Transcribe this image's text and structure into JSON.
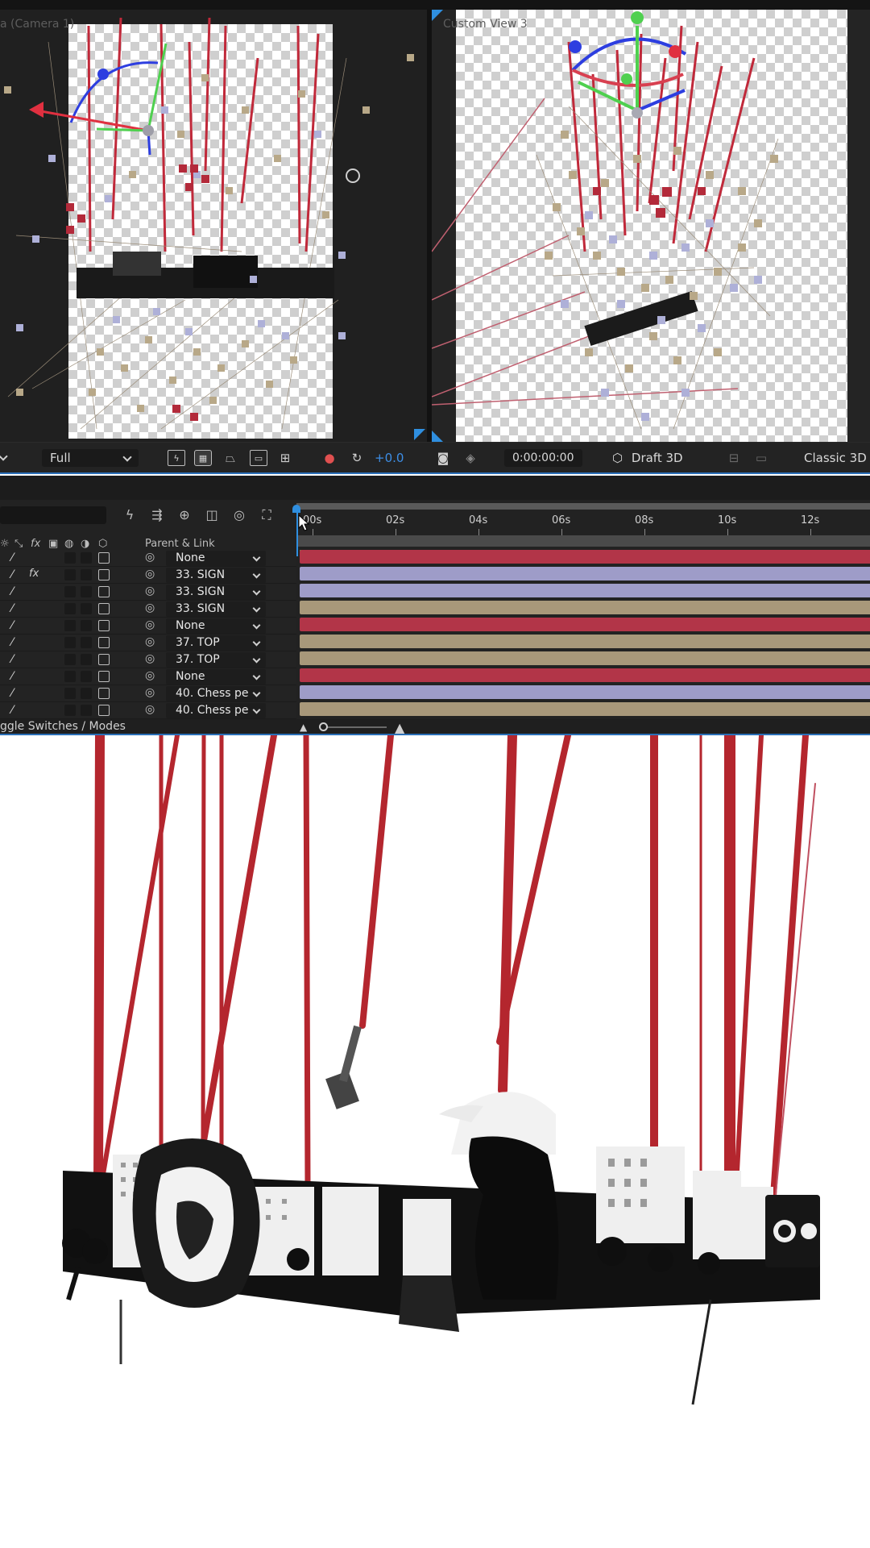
{
  "viewer": {
    "left_view_label": "a (Camera 1)",
    "right_view_label": "Custom View 3",
    "toolbar": {
      "resolution": "Full",
      "exposure": "+0.0",
      "timecode": "0:00:00:00",
      "renderer_mode": "Draft 3D",
      "renderer": "Classic 3D",
      "icons": [
        "fast-previews-icon",
        "transparency-grid-icon",
        "3d-ground-plane-icon",
        "region-of-interest-icon",
        "grid-guides-icon",
        "color-channels-icon",
        "reset-exposure-icon",
        "snapshot-camera-icon",
        "show-snapshot-icon",
        "3d-view-layout-icon",
        "display-options-icon"
      ]
    }
  },
  "timeline": {
    "ruler_labels": [
      "00s",
      "02s",
      "04s",
      "06s",
      "08s",
      "10s",
      "12s"
    ],
    "column_header": "Parent & Link",
    "footer_label": "ggle Switches / Modes",
    "layers": [
      {
        "parent": "None",
        "has_fx": false,
        "link_icon": "null",
        "track_color": "#b23548"
      },
      {
        "parent": "33. SIGN",
        "has_fx": true,
        "link_icon": "3d",
        "track_color": "#9e9cc8"
      },
      {
        "parent": "33. SIGN",
        "has_fx": false,
        "link_icon": "3d",
        "track_color": "#9e9cc8"
      },
      {
        "parent": "33. SIGN",
        "has_fx": false,
        "link_icon": "3d",
        "track_color": "#a8987a"
      },
      {
        "parent": "None",
        "has_fx": false,
        "link_icon": "null",
        "track_color": "#b23548"
      },
      {
        "parent": "37. TOP",
        "has_fx": false,
        "link_icon": "3d",
        "track_color": "#a8987a"
      },
      {
        "parent": "37. TOP",
        "has_fx": false,
        "link_icon": "3d",
        "track_color": "#a8987a"
      },
      {
        "parent": "None",
        "has_fx": false,
        "link_icon": "null",
        "track_color": "#b23548"
      },
      {
        "parent": "40. Chess pe",
        "has_fx": false,
        "link_icon": "3d",
        "track_color": "#9e9cc8"
      },
      {
        "parent": "40. Chess pe",
        "has_fx": false,
        "link_icon": "3d",
        "track_color": "#a8987a"
      }
    ]
  },
  "colors": {
    "accent_blue": "#2f8fe0",
    "string_red": "#b4262e",
    "cache_green": "#3ad13a"
  }
}
